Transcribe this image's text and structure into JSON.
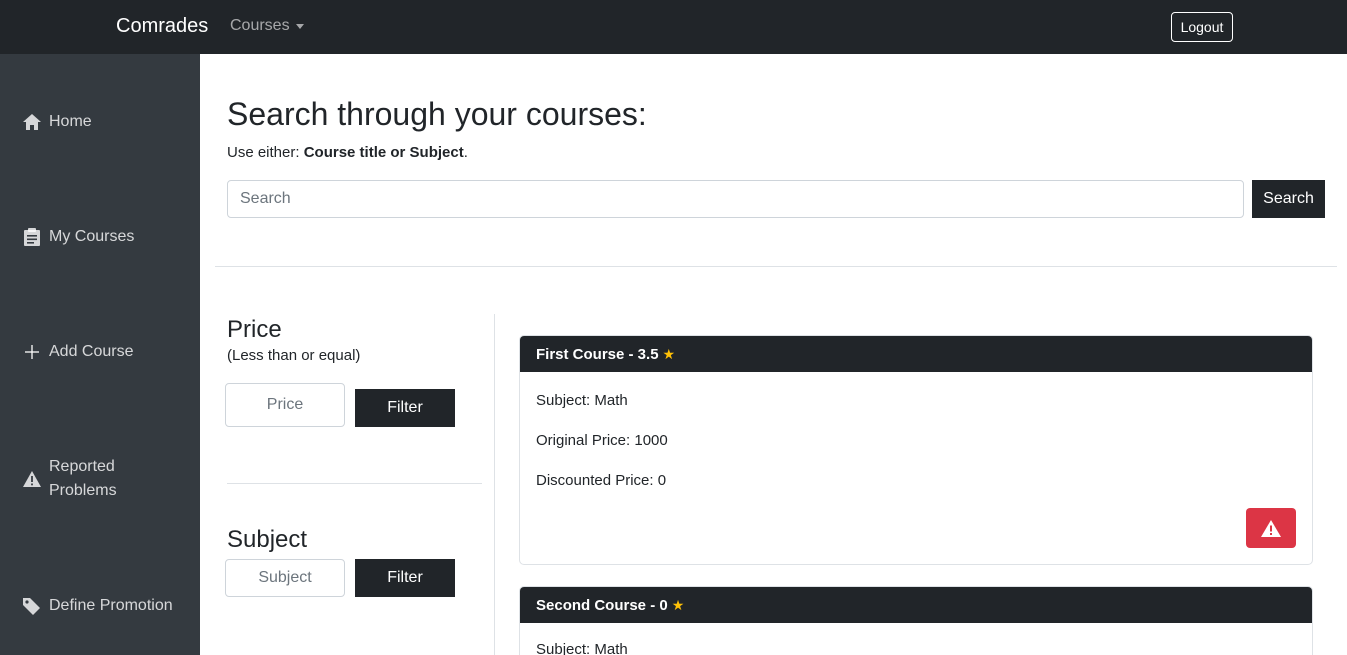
{
  "navbar": {
    "brand": "Comrades",
    "courses_menu": "Courses",
    "logout": "Logout"
  },
  "sidebar": {
    "items": [
      {
        "label": "Home",
        "icon": "home-icon"
      },
      {
        "label": "My Courses",
        "icon": "clipboard-icon"
      },
      {
        "label": "Add Course",
        "icon": "plus-icon"
      },
      {
        "label": "Reported Problems",
        "icon": "warning-icon"
      },
      {
        "label": "Define Promotion",
        "icon": "tags-icon"
      }
    ]
  },
  "search": {
    "title": "Search through your courses:",
    "hint_prefix": "Use either: ",
    "hint_bold": "Course title or Subject",
    "hint_suffix": ".",
    "placeholder": "Search",
    "button": "Search"
  },
  "filters": {
    "price": {
      "heading": "Price",
      "sub": "(Less than or equal)",
      "placeholder": "Price",
      "button": "Filter"
    },
    "subject": {
      "heading": "Subject",
      "placeholder": "Subject",
      "button": "Filter"
    }
  },
  "courses": [
    {
      "title": "First Course - 3.5",
      "subject": "Subject: Math",
      "original_price": "Original Price: 1000",
      "discounted_price": "Discounted Price: 0"
    },
    {
      "title": "Second Course - 0",
      "subject": "Subject: Math"
    }
  ],
  "colors": {
    "navbar": "#212529",
    "sidebar": "#343a40",
    "danger": "#dc3545",
    "star": "#ffc107"
  }
}
